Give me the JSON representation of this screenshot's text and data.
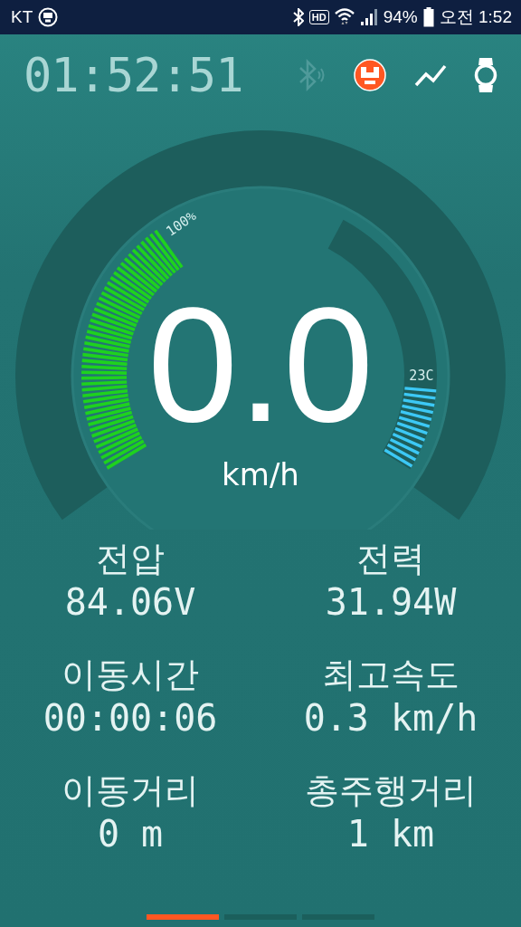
{
  "status_bar": {
    "carrier": "KT",
    "hd": "HD",
    "battery_percent": "94%",
    "time": "오전 1:52"
  },
  "header": {
    "clock": "01:52:51",
    "icons": [
      {
        "kind": "bluetooth",
        "selected": false,
        "disabled": true
      },
      {
        "kind": "wheel",
        "selected": true,
        "disabled": false
      },
      {
        "kind": "chart",
        "selected": false,
        "disabled": false
      },
      {
        "kind": "watch",
        "selected": false,
        "disabled": false
      }
    ]
  },
  "gauge": {
    "speed": "0.0",
    "unit": "km/h",
    "battery": {
      "label": "100%"
    },
    "temperature": {
      "label": "23C"
    }
  },
  "stats": [
    {
      "label": "전압",
      "value": "84.06V"
    },
    {
      "label": "전력",
      "value": "31.94W"
    },
    {
      "label": "이동시간",
      "value": "00:00:06"
    },
    {
      "label": "최고속도",
      "value": "0.3 km/h"
    },
    {
      "label": "이동거리",
      "value": "0 m"
    },
    {
      "label": "총주행거리",
      "value": "1 km"
    }
  ],
  "pages": [
    {
      "selected": true
    },
    {
      "selected": false
    },
    {
      "selected": false
    }
  ]
}
